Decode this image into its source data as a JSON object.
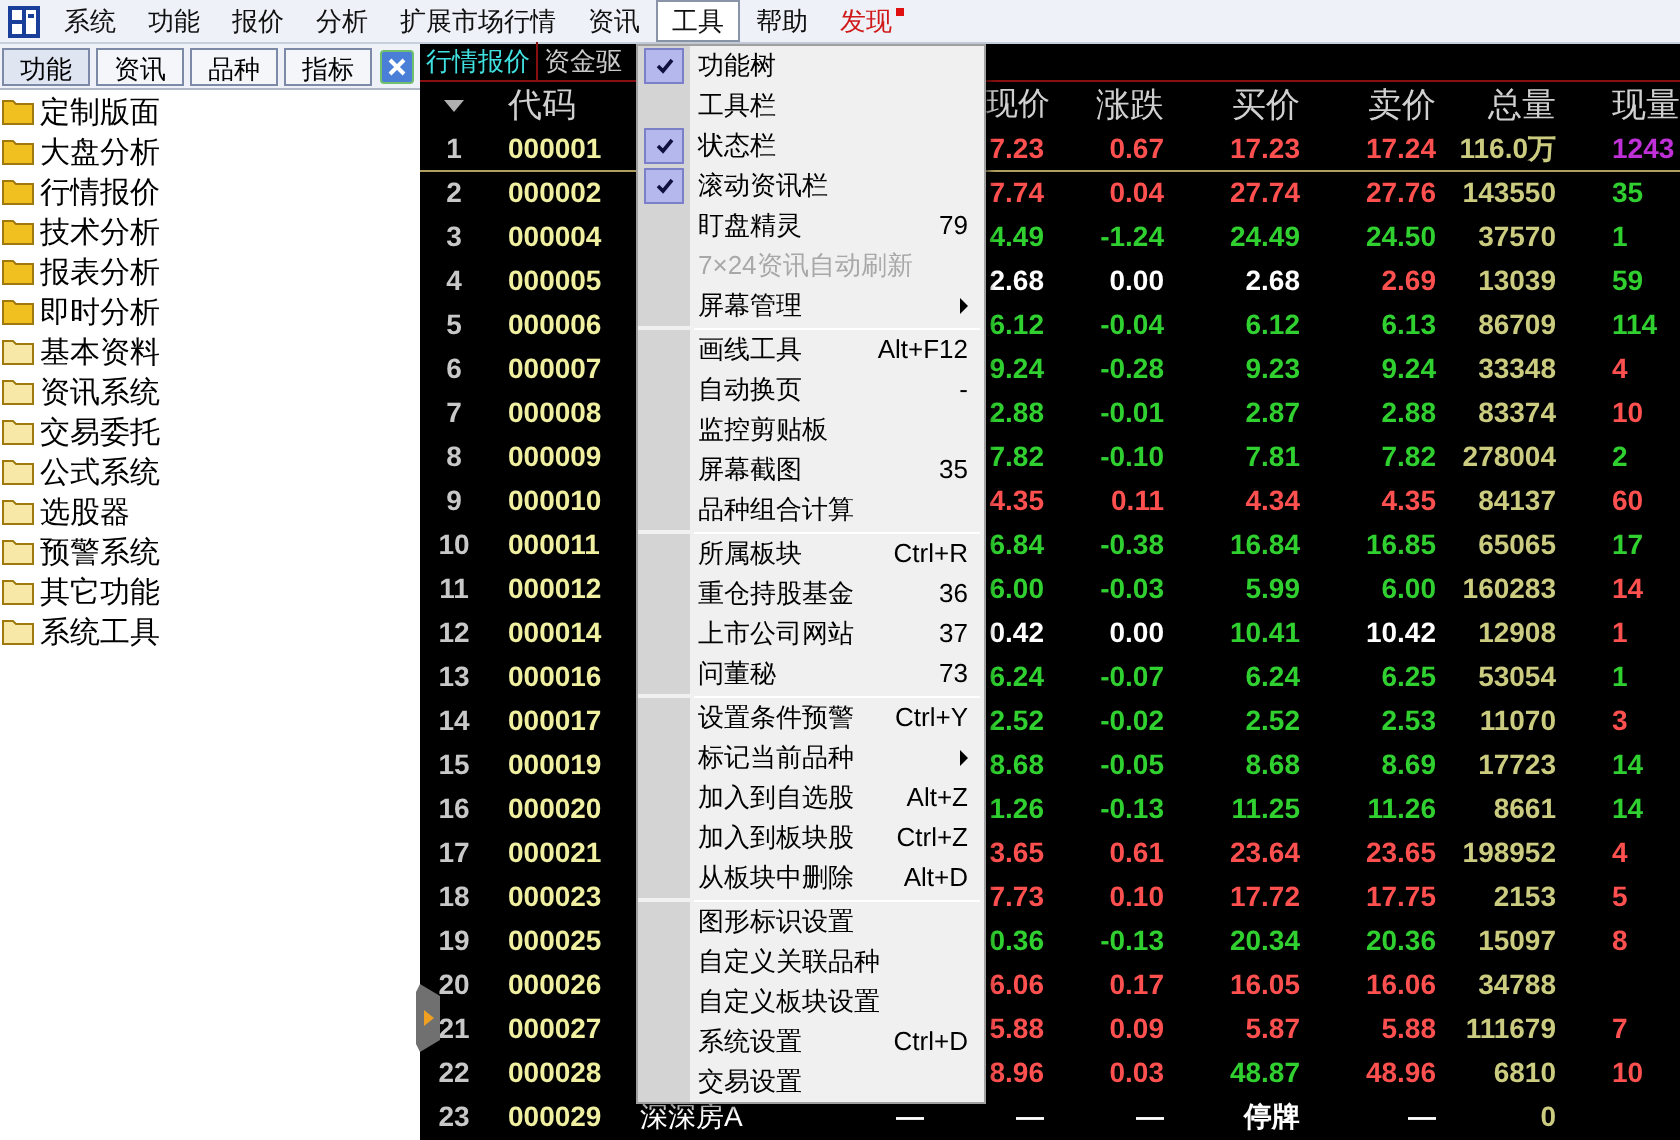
{
  "menubar": {
    "items": [
      {
        "label": "系统",
        "selected": false,
        "alert": false
      },
      {
        "label": "功能",
        "selected": false,
        "alert": false
      },
      {
        "label": "报价",
        "selected": false,
        "alert": false
      },
      {
        "label": "分析",
        "selected": false,
        "alert": false
      },
      {
        "label": "扩展市场行情",
        "selected": false,
        "alert": false
      },
      {
        "label": "资讯",
        "selected": false,
        "alert": false
      },
      {
        "label": "工具",
        "selected": true,
        "alert": false
      },
      {
        "label": "帮助",
        "selected": false,
        "alert": false
      },
      {
        "label": "发现",
        "selected": false,
        "alert": true
      }
    ]
  },
  "sidebar": {
    "tabs": [
      {
        "label": "功能",
        "selected": true
      },
      {
        "label": "资讯",
        "selected": false
      },
      {
        "label": "品种",
        "selected": false
      },
      {
        "label": "指标",
        "selected": false
      }
    ],
    "items": [
      {
        "label": "定制版面",
        "kind": "filled"
      },
      {
        "label": "大盘分析",
        "kind": "filled"
      },
      {
        "label": "行情报价",
        "kind": "filled"
      },
      {
        "label": "技术分析",
        "kind": "filled"
      },
      {
        "label": "报表分析",
        "kind": "filled"
      },
      {
        "label": "即时分析",
        "kind": "filled"
      },
      {
        "label": "基本资料",
        "kind": "light"
      },
      {
        "label": "资讯系统",
        "kind": "light"
      },
      {
        "label": "交易委托",
        "kind": "light"
      },
      {
        "label": "公式系统",
        "kind": "light"
      },
      {
        "label": "选股器",
        "kind": "light"
      },
      {
        "label": "预警系统",
        "kind": "light"
      },
      {
        "label": "其它功能",
        "kind": "light"
      },
      {
        "label": "系统工具",
        "kind": "light"
      }
    ]
  },
  "quote_tabs": [
    {
      "label": "行情报价",
      "selected": true
    },
    {
      "label": "资金驱",
      "selected": false
    }
  ],
  "table": {
    "header": {
      "code": "代码",
      "price": "现价",
      "change": "涨跌",
      "bid": "买价",
      "ask": "卖价",
      "volume": "总量",
      "current_volume": "现量"
    },
    "rows": [
      {
        "no": "1",
        "code": "000001",
        "selected": true,
        "price": {
          "text": "7.23",
          "color": "#ff5050"
        },
        "change": {
          "text": "0.67",
          "color": "#ff5050"
        },
        "bid": {
          "text": "17.23",
          "color": "#ff5050"
        },
        "ask": {
          "text": "17.24",
          "color": "#ff5050"
        },
        "volume": {
          "text": "116.0万",
          "color": "#cccc80"
        },
        "current_volume": {
          "text": "1243",
          "color": "#c030d8"
        }
      },
      {
        "no": "2",
        "code": "000002",
        "selected": false,
        "price": {
          "text": "7.74",
          "color": "#ff5050"
        },
        "change": {
          "text": "0.04",
          "color": "#ff5050"
        },
        "bid": {
          "text": "27.74",
          "color": "#ff5050"
        },
        "ask": {
          "text": "27.76",
          "color": "#ff5050"
        },
        "volume": {
          "text": "143550",
          "color": "#cccc80"
        },
        "current_volume": {
          "text": "35",
          "color": "#30d030"
        }
      },
      {
        "no": "3",
        "code": "000004",
        "selected": false,
        "price": {
          "text": "4.49",
          "color": "#30d030"
        },
        "change": {
          "text": "-1.24",
          "color": "#30d030"
        },
        "bid": {
          "text": "24.49",
          "color": "#30d030"
        },
        "ask": {
          "text": "24.50",
          "color": "#30d030"
        },
        "volume": {
          "text": "37570",
          "color": "#cccc80"
        },
        "current_volume": {
          "text": "1",
          "color": "#30d030"
        }
      },
      {
        "no": "4",
        "code": "000005",
        "selected": false,
        "price": {
          "text": "2.68",
          "color": "#ffffff"
        },
        "change": {
          "text": "0.00",
          "color": "#ffffff"
        },
        "bid": {
          "text": "2.68",
          "color": "#ffffff"
        },
        "ask": {
          "text": "2.69",
          "color": "#ff5050"
        },
        "volume": {
          "text": "13039",
          "color": "#cccc80"
        },
        "current_volume": {
          "text": "59",
          "color": "#30d030"
        }
      },
      {
        "no": "5",
        "code": "000006",
        "selected": false,
        "price": {
          "text": "6.12",
          "color": "#30d030"
        },
        "change": {
          "text": "-0.04",
          "color": "#30d030"
        },
        "bid": {
          "text": "6.12",
          "color": "#30d030"
        },
        "ask": {
          "text": "6.13",
          "color": "#30d030"
        },
        "volume": {
          "text": "86709",
          "color": "#cccc80"
        },
        "current_volume": {
          "text": "114",
          "color": "#30d030"
        }
      },
      {
        "no": "6",
        "code": "000007",
        "selected": false,
        "price": {
          "text": "9.24",
          "color": "#30d030"
        },
        "change": {
          "text": "-0.28",
          "color": "#30d030"
        },
        "bid": {
          "text": "9.23",
          "color": "#30d030"
        },
        "ask": {
          "text": "9.24",
          "color": "#30d030"
        },
        "volume": {
          "text": "33348",
          "color": "#cccc80"
        },
        "current_volume": {
          "text": "4",
          "color": "#ff5050"
        }
      },
      {
        "no": "7",
        "code": "000008",
        "selected": false,
        "price": {
          "text": "2.88",
          "color": "#30d030"
        },
        "change": {
          "text": "-0.01",
          "color": "#30d030"
        },
        "bid": {
          "text": "2.87",
          "color": "#30d030"
        },
        "ask": {
          "text": "2.88",
          "color": "#30d030"
        },
        "volume": {
          "text": "83374",
          "color": "#cccc80"
        },
        "current_volume": {
          "text": "10",
          "color": "#ff5050"
        }
      },
      {
        "no": "8",
        "code": "000009",
        "selected": false,
        "price": {
          "text": "7.82",
          "color": "#30d030"
        },
        "change": {
          "text": "-0.10",
          "color": "#30d030"
        },
        "bid": {
          "text": "7.81",
          "color": "#30d030"
        },
        "ask": {
          "text": "7.82",
          "color": "#30d030"
        },
        "volume": {
          "text": "278004",
          "color": "#cccc80"
        },
        "current_volume": {
          "text": "2",
          "color": "#30d030"
        }
      },
      {
        "no": "9",
        "code": "000010",
        "selected": false,
        "price": {
          "text": "4.35",
          "color": "#ff5050"
        },
        "change": {
          "text": "0.11",
          "color": "#ff5050"
        },
        "bid": {
          "text": "4.34",
          "color": "#ff5050"
        },
        "ask": {
          "text": "4.35",
          "color": "#ff5050"
        },
        "volume": {
          "text": "84137",
          "color": "#cccc80"
        },
        "current_volume": {
          "text": "60",
          "color": "#ff5050"
        }
      },
      {
        "no": "10",
        "code": "000011",
        "selected": false,
        "price": {
          "text": "6.84",
          "color": "#30d030"
        },
        "change": {
          "text": "-0.38",
          "color": "#30d030"
        },
        "bid": {
          "text": "16.84",
          "color": "#30d030"
        },
        "ask": {
          "text": "16.85",
          "color": "#30d030"
        },
        "volume": {
          "text": "65065",
          "color": "#cccc80"
        },
        "current_volume": {
          "text": "17",
          "color": "#30d030"
        }
      },
      {
        "no": "11",
        "code": "000012",
        "selected": false,
        "price": {
          "text": "6.00",
          "color": "#30d030"
        },
        "change": {
          "text": "-0.03",
          "color": "#30d030"
        },
        "bid": {
          "text": "5.99",
          "color": "#30d030"
        },
        "ask": {
          "text": "6.00",
          "color": "#30d030"
        },
        "volume": {
          "text": "160283",
          "color": "#cccc80"
        },
        "current_volume": {
          "text": "14",
          "color": "#ff5050"
        }
      },
      {
        "no": "12",
        "code": "000014",
        "selected": false,
        "price": {
          "text": "0.42",
          "color": "#ffffff"
        },
        "change": {
          "text": "0.00",
          "color": "#ffffff"
        },
        "bid": {
          "text": "10.41",
          "color": "#30d030"
        },
        "ask": {
          "text": "10.42",
          "color": "#ffffff"
        },
        "volume": {
          "text": "12908",
          "color": "#cccc80"
        },
        "current_volume": {
          "text": "1",
          "color": "#ff5050"
        }
      },
      {
        "no": "13",
        "code": "000016",
        "selected": false,
        "price": {
          "text": "6.24",
          "color": "#30d030"
        },
        "change": {
          "text": "-0.07",
          "color": "#30d030"
        },
        "bid": {
          "text": "6.24",
          "color": "#30d030"
        },
        "ask": {
          "text": "6.25",
          "color": "#30d030"
        },
        "volume": {
          "text": "53054",
          "color": "#cccc80"
        },
        "current_volume": {
          "text": "1",
          "color": "#30d030"
        }
      },
      {
        "no": "14",
        "code": "000017",
        "selected": false,
        "price": {
          "text": "2.52",
          "color": "#30d030"
        },
        "change": {
          "text": "-0.02",
          "color": "#30d030"
        },
        "bid": {
          "text": "2.52",
          "color": "#30d030"
        },
        "ask": {
          "text": "2.53",
          "color": "#30d030"
        },
        "volume": {
          "text": "11070",
          "color": "#cccc80"
        },
        "current_volume": {
          "text": "3",
          "color": "#ff5050"
        }
      },
      {
        "no": "15",
        "code": "000019",
        "selected": false,
        "price": {
          "text": "8.68",
          "color": "#30d030"
        },
        "change": {
          "text": "-0.05",
          "color": "#30d030"
        },
        "bid": {
          "text": "8.68",
          "color": "#30d030"
        },
        "ask": {
          "text": "8.69",
          "color": "#30d030"
        },
        "volume": {
          "text": "17723",
          "color": "#cccc80"
        },
        "current_volume": {
          "text": "14",
          "color": "#30d030"
        }
      },
      {
        "no": "16",
        "code": "000020",
        "selected": false,
        "price": {
          "text": "1.26",
          "color": "#30d030"
        },
        "change": {
          "text": "-0.13",
          "color": "#30d030"
        },
        "bid": {
          "text": "11.25",
          "color": "#30d030"
        },
        "ask": {
          "text": "11.26",
          "color": "#30d030"
        },
        "volume": {
          "text": "8661",
          "color": "#cccc80"
        },
        "current_volume": {
          "text": "14",
          "color": "#30d030"
        }
      },
      {
        "no": "17",
        "code": "000021",
        "selected": false,
        "price": {
          "text": "3.65",
          "color": "#ff5050"
        },
        "change": {
          "text": "0.61",
          "color": "#ff5050"
        },
        "bid": {
          "text": "23.64",
          "color": "#ff5050"
        },
        "ask": {
          "text": "23.65",
          "color": "#ff5050"
        },
        "volume": {
          "text": "198952",
          "color": "#cccc80"
        },
        "current_volume": {
          "text": "4",
          "color": "#ff5050"
        }
      },
      {
        "no": "18",
        "code": "000023",
        "selected": false,
        "price": {
          "text": "7.73",
          "color": "#ff5050"
        },
        "change": {
          "text": "0.10",
          "color": "#ff5050"
        },
        "bid": {
          "text": "17.72",
          "color": "#ff5050"
        },
        "ask": {
          "text": "17.75",
          "color": "#ff5050"
        },
        "volume": {
          "text": "2153",
          "color": "#cccc80"
        },
        "current_volume": {
          "text": "5",
          "color": "#ff5050"
        }
      },
      {
        "no": "19",
        "code": "000025",
        "selected": false,
        "price": {
          "text": "0.36",
          "color": "#30d030"
        },
        "change": {
          "text": "-0.13",
          "color": "#30d030"
        },
        "bid": {
          "text": "20.34",
          "color": "#30d030"
        },
        "ask": {
          "text": "20.36",
          "color": "#30d030"
        },
        "volume": {
          "text": "15097",
          "color": "#cccc80"
        },
        "current_volume": {
          "text": "8",
          "color": "#ff5050"
        }
      },
      {
        "no": "20",
        "code": "000026",
        "selected": false,
        "price": {
          "text": "6.06",
          "color": "#ff5050"
        },
        "change": {
          "text": "0.17",
          "color": "#ff5050"
        },
        "bid": {
          "text": "16.05",
          "color": "#ff5050"
        },
        "ask": {
          "text": "16.06",
          "color": "#ff5050"
        },
        "volume": {
          "text": "34788",
          "color": "#cccc80"
        }
      },
      {
        "no": "21",
        "code": "000027",
        "selected": false,
        "price": {
          "text": "5.88",
          "color": "#ff5050"
        },
        "change": {
          "text": "0.09",
          "color": "#ff5050"
        },
        "bid": {
          "text": "5.87",
          "color": "#ff5050"
        },
        "ask": {
          "text": "5.88",
          "color": "#ff5050"
        },
        "volume": {
          "text": "111679",
          "color": "#cccc80"
        },
        "current_volume": {
          "text": "7",
          "color": "#ff5050"
        }
      },
      {
        "no": "22",
        "code": "000028",
        "selected": false,
        "price": {
          "text": "8.96",
          "color": "#ff5050"
        },
        "change": {
          "text": "0.03",
          "color": "#ff5050"
        },
        "bid": {
          "text": "48.87",
          "color": "#30d030"
        },
        "ask": {
          "text": "48.96",
          "color": "#ff5050"
        },
        "volume": {
          "text": "6810",
          "color": "#cccc80"
        },
        "current_volume": {
          "text": "10",
          "color": "#ff5050"
        }
      },
      {
        "no": "23",
        "code": "000029",
        "selected": false,
        "name": {
          "text": "深深房A",
          "color": "#ffffff"
        },
        "column_4": {
          "text": "—",
          "color": "#ffffff"
        },
        "price": {
          "text": "—",
          "color": "#ffffff"
        },
        "change": {
          "text": "—",
          "color": "#ffffff"
        },
        "bid": {
          "text": "停牌",
          "color": "#ffffff"
        },
        "ask": {
          "text": "—",
          "color": "#ffffff"
        },
        "volume": {
          "text": "0",
          "color": "#cccc80"
        }
      }
    ]
  },
  "menu": [
    {
      "kind": "item",
      "label": "功能树",
      "checked": true,
      "disabled": false,
      "submenu": false
    },
    {
      "kind": "item",
      "label": "工具栏",
      "checked": false,
      "disabled": false,
      "submenu": false
    },
    {
      "kind": "item",
      "label": "状态栏",
      "checked": true,
      "disabled": false,
      "submenu": false
    },
    {
      "kind": "item",
      "label": "滚动资讯栏",
      "checked": true,
      "disabled": false,
      "submenu": false
    },
    {
      "kind": "item",
      "label": "盯盘精灵",
      "shortcut": "79",
      "checked": false,
      "disabled": false,
      "submenu": false
    },
    {
      "kind": "item",
      "label": "7×24资讯自动刷新",
      "checked": false,
      "disabled": true,
      "submenu": false
    },
    {
      "kind": "item",
      "label": "屏幕管理",
      "checked": false,
      "disabled": false,
      "submenu": true
    },
    {
      "kind": "separator"
    },
    {
      "kind": "item",
      "label": "画线工具",
      "shortcut": "Alt+F12",
      "checked": false,
      "disabled": false,
      "submenu": false
    },
    {
      "kind": "item",
      "label": "自动换页",
      "shortcut": "-",
      "checked": false,
      "disabled": false,
      "submenu": false
    },
    {
      "kind": "item",
      "label": "监控剪贴板",
      "checked": false,
      "disabled": false,
      "submenu": false
    },
    {
      "kind": "item",
      "label": "屏幕截图",
      "shortcut": "35",
      "checked": false,
      "disabled": false,
      "submenu": false
    },
    {
      "kind": "item",
      "label": "品种组合计算",
      "checked": false,
      "disabled": false,
      "submenu": false
    },
    {
      "kind": "separator"
    },
    {
      "kind": "item",
      "label": "所属板块",
      "shortcut": "Ctrl+R",
      "checked": false,
      "disabled": false,
      "submenu": false
    },
    {
      "kind": "item",
      "label": "重仓持股基金",
      "shortcut": "36",
      "checked": false,
      "disabled": false,
      "submenu": false
    },
    {
      "kind": "item",
      "label": "上市公司网站",
      "shortcut": "37",
      "checked": false,
      "disabled": false,
      "submenu": false
    },
    {
      "kind": "item",
      "label": "问董秘",
      "shortcut": "73",
      "checked": false,
      "disabled": false,
      "submenu": false
    },
    {
      "kind": "separator"
    },
    {
      "kind": "item",
      "label": "设置条件预警",
      "shortcut": "Ctrl+Y",
      "checked": false,
      "disabled": false,
      "submenu": false
    },
    {
      "kind": "item",
      "label": "标记当前品种",
      "checked": false,
      "disabled": false,
      "submenu": true
    },
    {
      "kind": "item",
      "label": "加入到自选股",
      "shortcut": "Alt+Z",
      "checked": false,
      "disabled": false,
      "submenu": false
    },
    {
      "kind": "item",
      "label": "加入到板块股",
      "shortcut": "Ctrl+Z",
      "checked": false,
      "disabled": false,
      "submenu": false
    },
    {
      "kind": "item",
      "label": "从板块中删除",
      "shortcut": "Alt+D",
      "checked": false,
      "disabled": false,
      "submenu": false
    },
    {
      "kind": "separator"
    },
    {
      "kind": "item",
      "label": "图形标识设置",
      "checked": false,
      "disabled": false,
      "submenu": false
    },
    {
      "kind": "item",
      "label": "自定义关联品种",
      "checked": false,
      "disabled": false,
      "submenu": false
    },
    {
      "kind": "item",
      "label": "自定义板块设置",
      "checked": false,
      "disabled": false,
      "submenu": false
    },
    {
      "kind": "item",
      "label": "系统设置",
      "shortcut": "Ctrl+D",
      "checked": false,
      "disabled": false,
      "submenu": false
    },
    {
      "kind": "item",
      "label": "交易设置",
      "checked": false,
      "disabled": false,
      "submenu": false
    }
  ]
}
